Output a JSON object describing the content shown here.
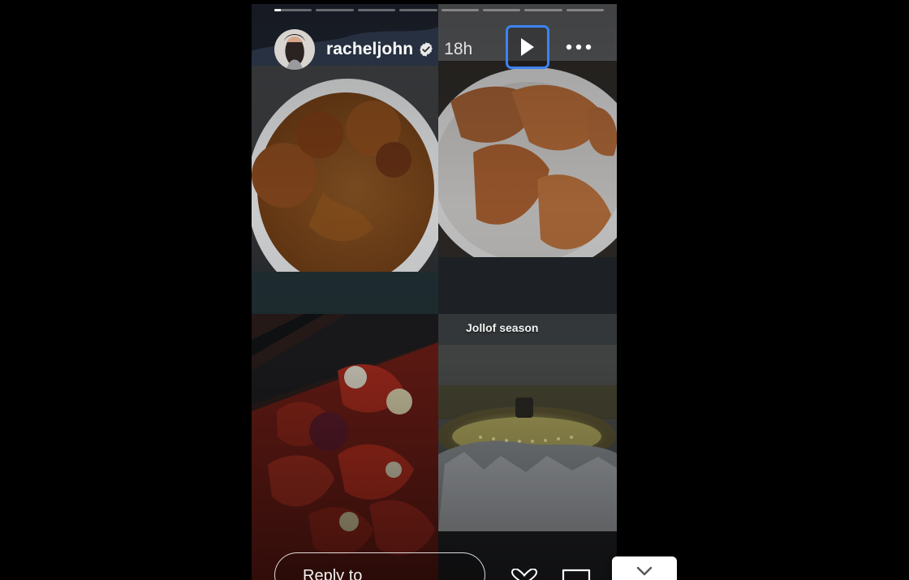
{
  "story": {
    "username": "racheljohn",
    "time": "18h",
    "caption": "Jollof season",
    "reply_placeholder": "Reply to",
    "progress_segments_total": 8,
    "progress_segment_current": 1,
    "progress_current_fraction": 0.18
  },
  "icons": {
    "avatar": "avatar",
    "verified": "verified-badge-icon",
    "play": "play-icon",
    "more": "more-horizontal-icon",
    "like": "heart-icon",
    "share": "share-icon",
    "collapse": "chevron-down-icon"
  },
  "colors": {
    "background": "#000000",
    "text": "#ffffff",
    "accent_focus": "#3c84f0"
  }
}
